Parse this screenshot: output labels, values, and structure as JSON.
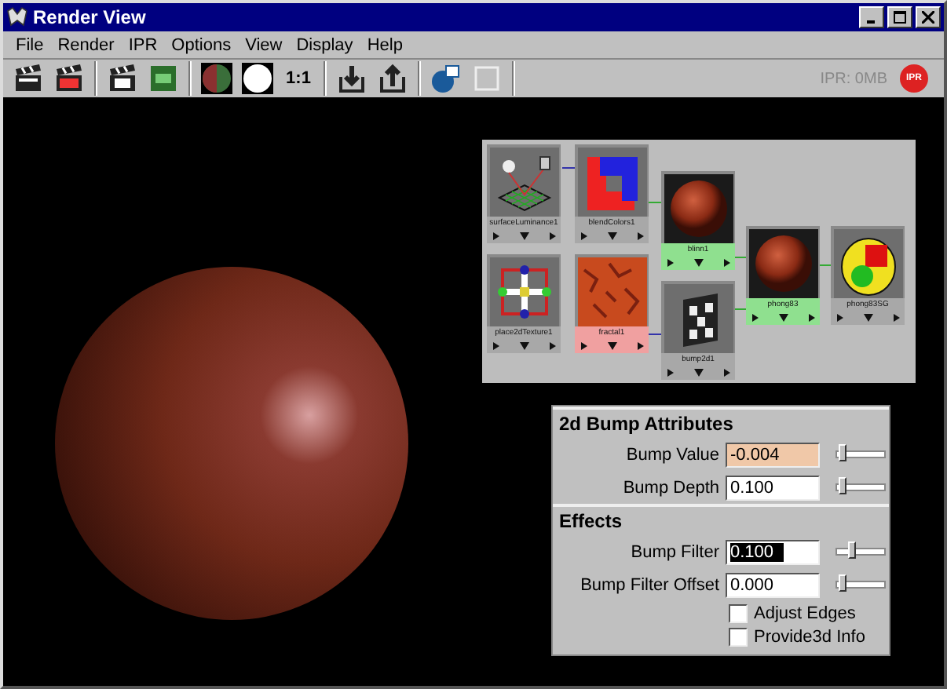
{
  "window": {
    "title": "Render View"
  },
  "menu": [
    "File",
    "Render",
    "IPR",
    "Options",
    "View",
    "Display",
    "Help"
  ],
  "toolbar": [
    {
      "kind": "clapper"
    },
    {
      "kind": "clapper-red"
    },
    {
      "kind": "sep"
    },
    {
      "kind": "clapper-ipr"
    },
    {
      "kind": "ipr-green"
    },
    {
      "kind": "sep"
    },
    {
      "kind": "rgb-circle"
    },
    {
      "kind": "white-circle"
    },
    {
      "kind": "text",
      "label": "1:1"
    },
    {
      "kind": "sep"
    },
    {
      "kind": "keep"
    },
    {
      "kind": "remove"
    },
    {
      "kind": "sep"
    },
    {
      "kind": "camera"
    },
    {
      "kind": "region"
    },
    {
      "kind": "sep"
    }
  ],
  "ipr_status": {
    "memory": "IPR: 0MB",
    "button": "IPR"
  },
  "graph": {
    "nodes": [
      {
        "label": "surfaceLuminance1",
        "kind": "light",
        "color": "#a8a8a8"
      },
      {
        "label": "blendColors1",
        "kind": "swirl",
        "color": "#a8a8a8"
      },
      {
        "label": "blinn1",
        "kind": "ball",
        "color": "#8fe08f"
      },
      {
        "label": "place2dTexture1",
        "kind": "place",
        "color": "#a8a8a8"
      },
      {
        "label": "fractal1",
        "kind": "fractal",
        "color": "#f0a0a0"
      },
      {
        "label": "bump2d1",
        "kind": "checker",
        "color": "#a8a8a8"
      },
      {
        "label": "phong83",
        "kind": "ball",
        "color": "#8fe08f"
      },
      {
        "label": "phong83SG",
        "kind": "sg",
        "color": "#a8a8a8"
      }
    ]
  },
  "attributes": {
    "sections": [
      {
        "title": "2d Bump Attributes",
        "rows": [
          {
            "kind": "field",
            "label": "Bump Value",
            "value": "-0.004",
            "keyed": true,
            "text_selected": false,
            "level": 0.1
          },
          {
            "kind": "field",
            "label": "Bump Depth",
            "value": "0.100",
            "keyed": false,
            "text_selected": false,
            "level": 0.1
          }
        ]
      },
      {
        "title": "Effects",
        "rows": [
          {
            "kind": "field",
            "label": "Bump Filter",
            "value": "0.100",
            "keyed": false,
            "text_selected": true,
            "level": 0.3
          },
          {
            "kind": "field",
            "label": "Bump Filter Offset",
            "value": "0.000",
            "keyed": false,
            "text_selected": false,
            "level": 0.1
          },
          {
            "kind": "check",
            "label": "Adjust Edges",
            "checked": false
          },
          {
            "kind": "check",
            "label": "Provide3d Info",
            "checked": false
          }
        ]
      }
    ]
  }
}
